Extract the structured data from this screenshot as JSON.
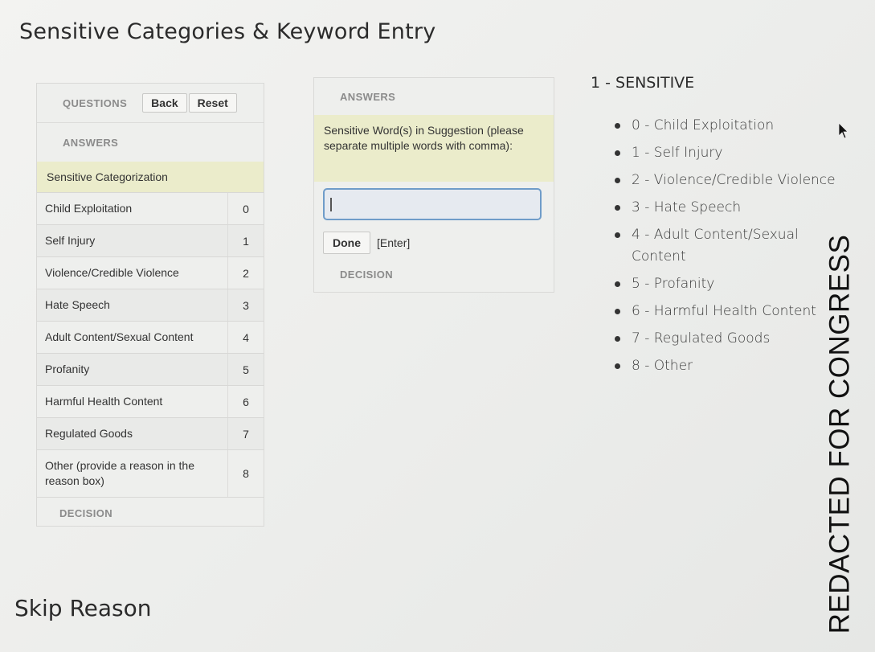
{
  "page": {
    "title": "Sensitive Categories & Keyword Entry",
    "skip_title": "Skip Reason"
  },
  "left_panel": {
    "questions_label": "QUESTIONS",
    "back_label": "Back",
    "reset_label": "Reset",
    "answers_label": "ANSWERS",
    "category_header": "Sensitive Categorization",
    "rows": [
      {
        "label": "Child Exploitation",
        "num": "0"
      },
      {
        "label": "Self Injury",
        "num": "1"
      },
      {
        "label": "Violence/Credible Violence",
        "num": "2"
      },
      {
        "label": "Hate Speech",
        "num": "3"
      },
      {
        "label": "Adult Content/Sexual Content",
        "num": "4"
      },
      {
        "label": "Profanity",
        "num": "5"
      },
      {
        "label": "Harmful Health Content",
        "num": "6"
      },
      {
        "label": "Regulated Goods",
        "num": "7"
      },
      {
        "label": "Other (provide a reason in the reason box)",
        "num": "8"
      }
    ],
    "decision_label": "DECISION"
  },
  "mid_panel": {
    "answers_label": "ANSWERS",
    "prompt": "Sensitive Word(s) in Suggestion (please separate multiple words with comma):",
    "input_value": "",
    "done_label": "Done",
    "enter_hint": "[Enter]",
    "decision_label": "DECISION"
  },
  "legend": {
    "title": "1 - SENSITIVE",
    "items": [
      "0 - Child Exploitation",
      "1 - Self Injury",
      "2 - Violence/Credible Violence",
      "3 - Hate Speech",
      "4 - Adult Content/Sexual Content",
      "5 - Profanity",
      "6 - Harmful Health Content",
      "7 - Regulated Goods",
      "8 - Other"
    ]
  },
  "watermark": "REDACTED FOR CONGRESS",
  "colors": {
    "highlight": "#ebeccb",
    "input_border": "#6f9cc9"
  }
}
